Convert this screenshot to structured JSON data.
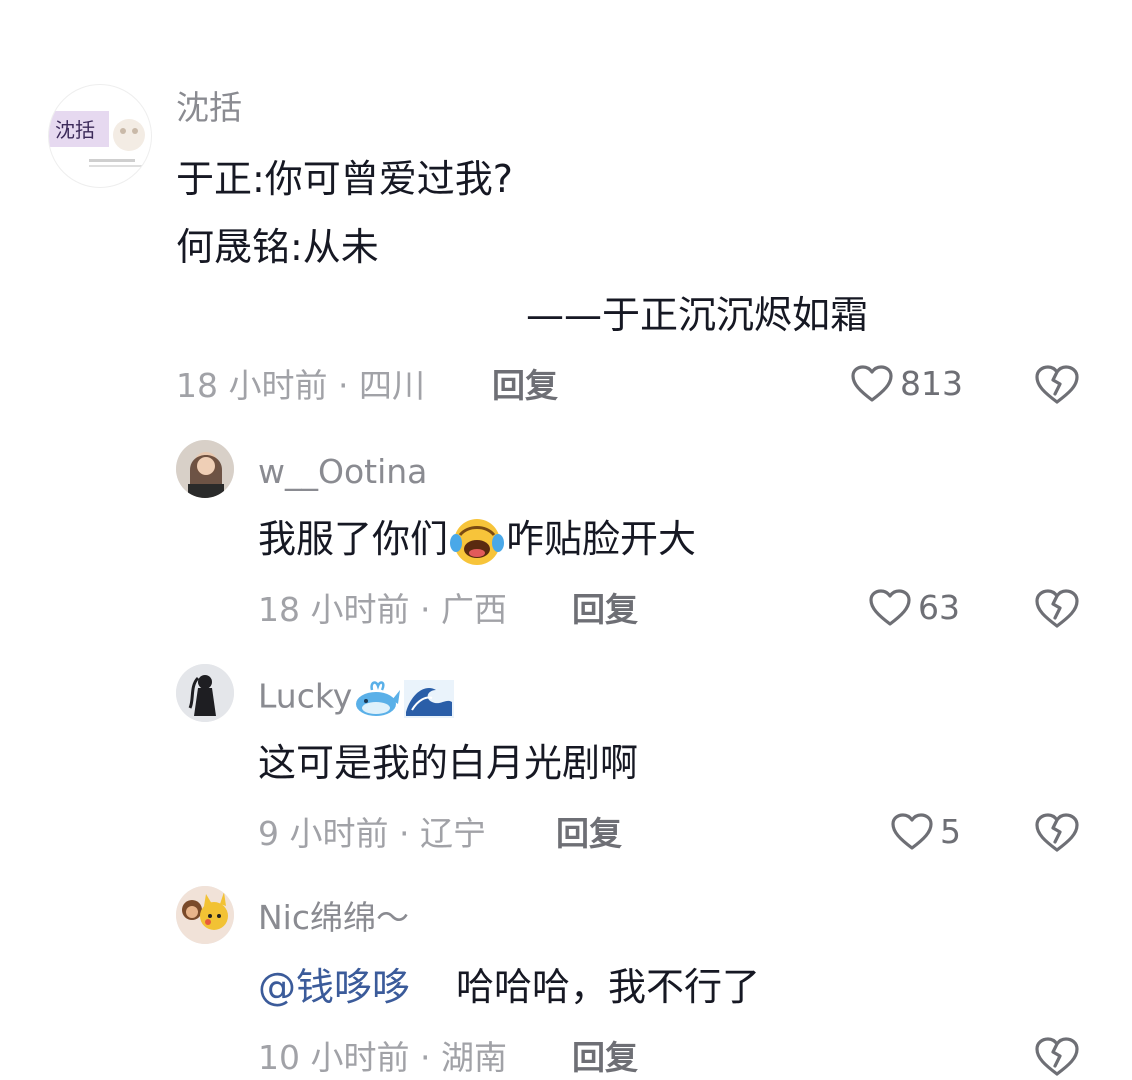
{
  "comments": [
    {
      "username": "沈括",
      "avatar_text": "沈括",
      "lines": [
        "于正:你可曾爱过我?",
        "何晟铭:从未",
        "——于正沉沉烬如霜"
      ],
      "time_location": "18 小时前 · 四川",
      "reply_label": "回复",
      "likes": "813"
    },
    {
      "username": "w__Ootina",
      "text_before": "我服了你们",
      "text_after": "咋贴脸开大",
      "emoji": "rolling-laughing-emoji",
      "time_location": "18 小时前 · 广西",
      "reply_label": "回复",
      "likes": "63"
    },
    {
      "username": "Lucky",
      "username_emojis": [
        "whale-emoji",
        "wave-emoji"
      ],
      "text": "这可是我的白月光剧啊",
      "time_location": "9 小时前 · 辽宁",
      "reply_label": "回复",
      "likes": "5"
    },
    {
      "username": "Nic绵绵～",
      "mention": "@钱哆哆",
      "text": "哈哈哈，我不行了",
      "time_location": "10 小时前 · 湖南",
      "reply_label": "回复"
    }
  ],
  "icons": {
    "like": "heart-outline-icon",
    "dislike": "broken-heart-icon"
  },
  "colors": {
    "text": "#161823",
    "muted": "#a1a2a7",
    "username": "#8a8b91",
    "mention": "#3b5b9a"
  }
}
